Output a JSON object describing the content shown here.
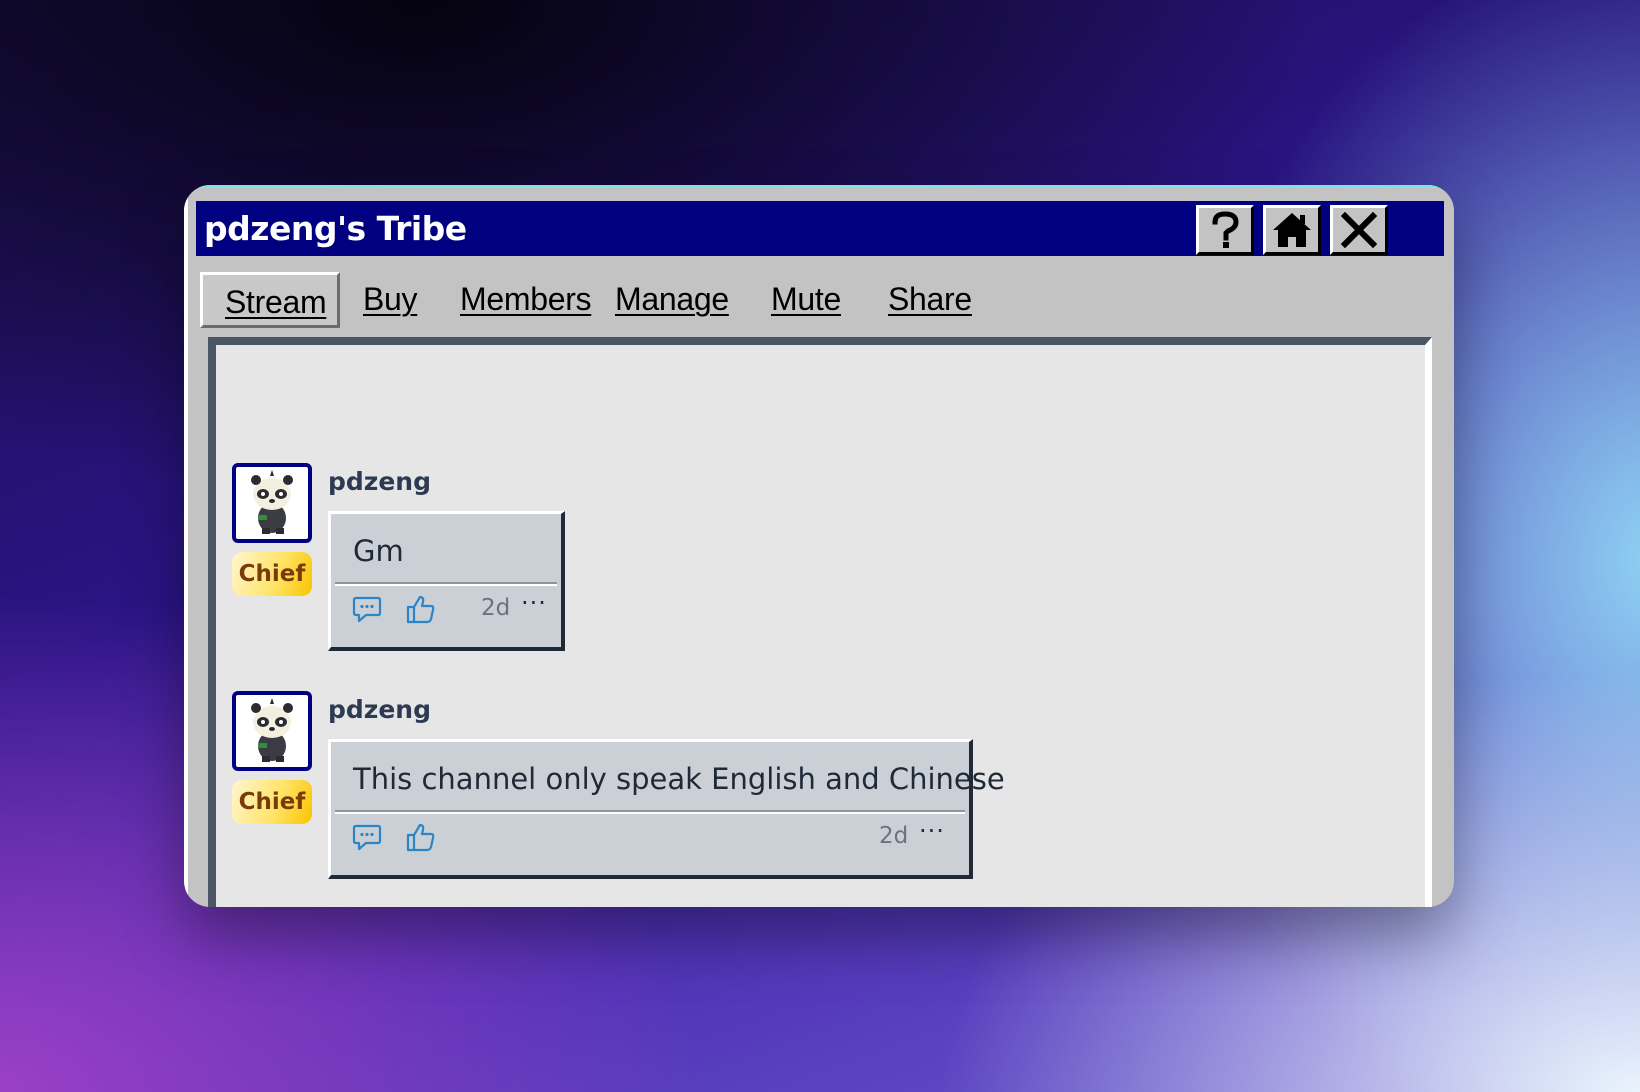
{
  "window": {
    "title": "pdzeng's Tribe",
    "buttons": {
      "help": "help-icon",
      "home": "home-icon",
      "close": "close-icon"
    }
  },
  "menu": {
    "items": [
      {
        "label": "Stream",
        "active": true
      },
      {
        "label": "Buy"
      },
      {
        "label": "Members"
      },
      {
        "label": "Manage"
      },
      {
        "label": "Mute"
      },
      {
        "label": "Share"
      }
    ]
  },
  "messages": [
    {
      "author": "pdzeng",
      "badge": "Chief",
      "text": "Gm",
      "time": "2d",
      "more": "···"
    },
    {
      "author": "pdzeng",
      "badge": "Chief",
      "text": "This channel only speak English and Chinese",
      "time": "2d",
      "more": "···"
    }
  ],
  "colors": {
    "titlebar": "#000080",
    "window": "#c3c3c3",
    "accent_icons": "#2a86c8",
    "badge_text": "#7a3b0b"
  }
}
